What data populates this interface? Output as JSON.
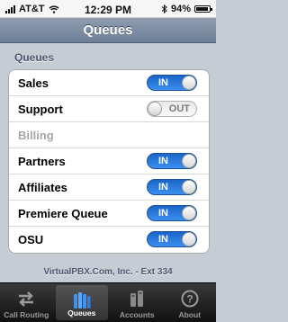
{
  "status_bar": {
    "carrier": "AT&T",
    "time": "12:29 PM",
    "battery": "94%",
    "battery_level": 0.94
  },
  "nav": {
    "title": "Queues"
  },
  "section": {
    "header": "Queues"
  },
  "queues": [
    {
      "name": "Sales",
      "state": "on",
      "toggle_label": "IN"
    },
    {
      "name": "Support",
      "state": "off",
      "toggle_label": "OUT"
    },
    {
      "name": "Billing",
      "state": "disabled",
      "toggle_label": ""
    },
    {
      "name": "Partners",
      "state": "on",
      "toggle_label": "IN"
    },
    {
      "name": "Affiliates",
      "state": "on",
      "toggle_label": "IN"
    },
    {
      "name": "Premiere Queue",
      "state": "on",
      "toggle_label": "IN"
    },
    {
      "name": "OSU",
      "state": "on",
      "toggle_label": "IN"
    }
  ],
  "footer": {
    "text": "VirtualPBX.Com, Inc. - Ext 334"
  },
  "tabs": [
    {
      "label": "Call Routing",
      "icon": "arrows-icon",
      "selected": false
    },
    {
      "label": "Queues",
      "icon": "queues-icon",
      "selected": true
    },
    {
      "label": "Accounts",
      "icon": "accounts-icon",
      "selected": false
    },
    {
      "label": "About",
      "icon": "help-icon",
      "selected": false
    }
  ],
  "colors": {
    "nav_bar": "#7b8ba1",
    "toggle_on": "#2f7ee6",
    "background": "#c5ccd4"
  }
}
